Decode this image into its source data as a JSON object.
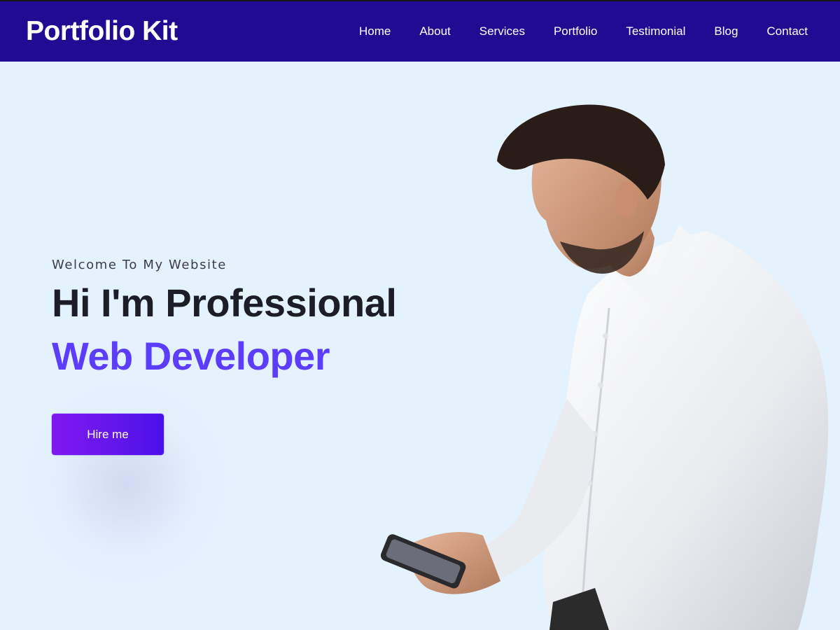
{
  "header": {
    "brand": "Portfolio Kit",
    "nav": [
      {
        "label": "Home"
      },
      {
        "label": "About"
      },
      {
        "label": "Services"
      },
      {
        "label": "Portfolio"
      },
      {
        "label": "Testimonial"
      },
      {
        "label": "Blog"
      },
      {
        "label": "Contact"
      }
    ]
  },
  "hero": {
    "kicker": "Welcome To My Website",
    "headline": "Hi I'm Professional",
    "headline_accent": "Web Developer",
    "cta_label": "Hire me"
  },
  "colors": {
    "header_bg": "#220b93",
    "page_bg": "#e4f2fe",
    "accent": "#5c3dfc",
    "button_start": "#7f19ee",
    "button_end": "#4b10e8"
  }
}
